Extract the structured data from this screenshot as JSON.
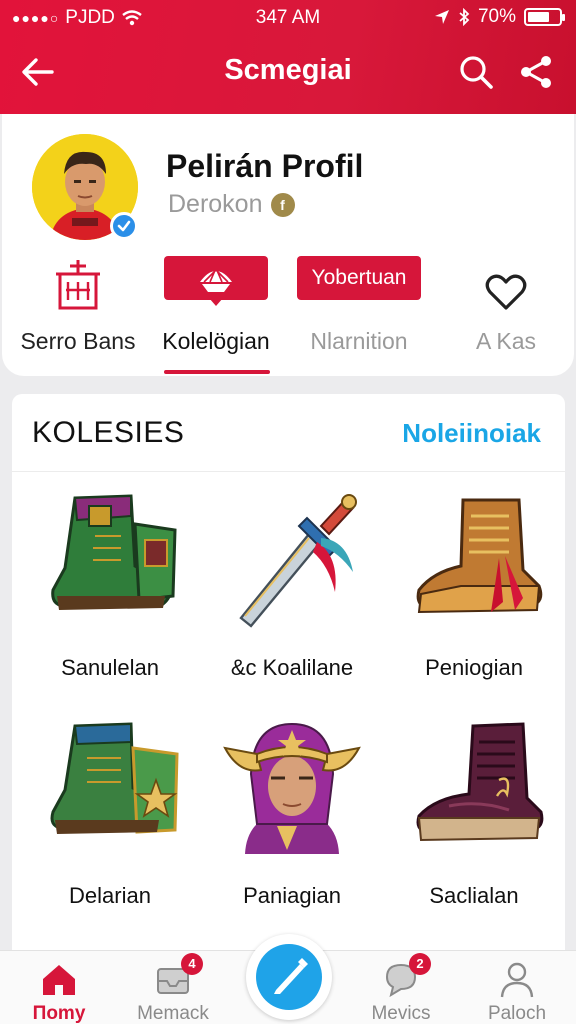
{
  "status": {
    "carrier": "PJDD",
    "time": "347 AM",
    "battery": "70%",
    "battery_level": 0.7
  },
  "header": {
    "title": "Scmegiai"
  },
  "profile": {
    "name": "Pelirán Profil",
    "subtitle": "Derokon",
    "coin_symbol": "f"
  },
  "tabs": [
    {
      "label": "Serro Bans",
      "icon": "building-icon"
    },
    {
      "label": "Kolelögian",
      "icon": "crown-fan-icon",
      "active": true
    },
    {
      "label": "Nlarnition",
      "button": "Yobertuan"
    },
    {
      "label": "A Kas",
      "icon": "heart-icon"
    }
  ],
  "collection": {
    "title": "KOLESIES",
    "link": "Noleiinoiak",
    "items": [
      {
        "label": "Sanulelan",
        "icon": "green-boot-icon"
      },
      {
        "label": "&c Koalilane",
        "icon": "sword-icon"
      },
      {
        "label": "Peniogian",
        "icon": "brown-boot-icon"
      },
      {
        "label": "Delarian",
        "icon": "star-boot-icon"
      },
      {
        "label": "Paniagian",
        "icon": "helmet-portrait-icon"
      },
      {
        "label": "Saclialan",
        "icon": "purple-boot-icon"
      }
    ]
  },
  "bottom_nav": [
    {
      "label": "Πomy",
      "icon": "home-icon",
      "active": true
    },
    {
      "label": "Memack",
      "icon": "inbox-icon",
      "badge": "4"
    },
    {
      "label": "",
      "icon": "pen-icon"
    },
    {
      "label": "Mevics",
      "icon": "chat-icon",
      "badge": "2"
    },
    {
      "label": "Paloch",
      "icon": "person-icon"
    }
  ],
  "colors": {
    "brand": "#d6163a",
    "accent": "#1aa6e6"
  }
}
